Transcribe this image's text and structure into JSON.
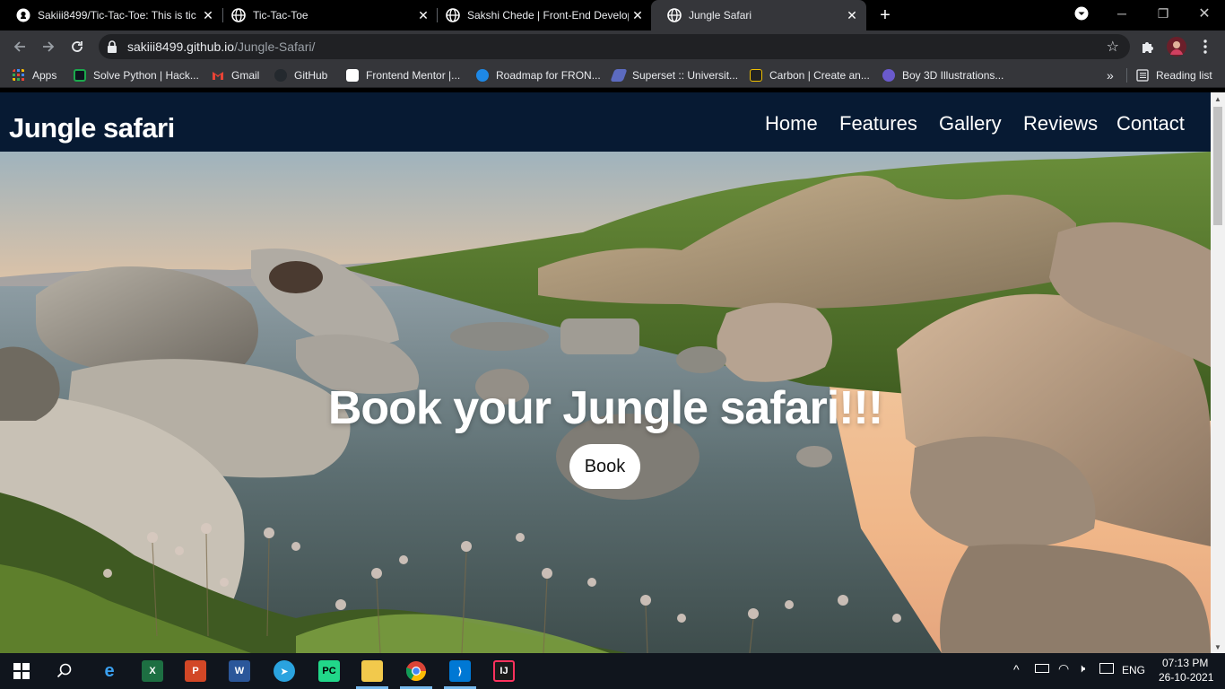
{
  "browser": {
    "tabs": [
      {
        "title": "Sakiii8499/Tic-Tac-Toe: This is tic",
        "icon": "github-icon",
        "active": false
      },
      {
        "title": "Tic-Tac-Toe",
        "icon": "globe-icon",
        "active": false
      },
      {
        "title": "Sakshi Chede | Front-End Develop",
        "icon": "globe-icon",
        "active": false
      },
      {
        "title": "Jungle Safari",
        "icon": "globe-icon",
        "active": true
      }
    ],
    "url_host": "sakiii8499.github.io",
    "url_path": "/Jungle-Safari/",
    "bookmarks": [
      {
        "label": "Apps",
        "color": "#4285f4"
      },
      {
        "label": "Solve Python | Hack...",
        "color": "#1ba94c"
      },
      {
        "label": "Gmail",
        "color": "#ea4335"
      },
      {
        "label": "GitHub",
        "color": "#24292e"
      },
      {
        "label": "Frontend Mentor |...",
        "color": "#ffffff"
      },
      {
        "label": "Roadmap for FRON...",
        "color": "#1e88e5"
      },
      {
        "label": "Superset :: Universit...",
        "color": "#5c6bc0"
      },
      {
        "label": "Carbon | Create an...",
        "color": "#222222"
      },
      {
        "label": "Boy 3D Illustrations...",
        "color": "#6a5acd"
      }
    ],
    "overflow_label": "»",
    "reading_list_label": "Reading list"
  },
  "site": {
    "brand": "Jungle safari",
    "nav": [
      "Home",
      "Features",
      "Gallery",
      "Reviews",
      "Contact"
    ],
    "headline": "Book your Jungle safari!!!",
    "cta_label": "Book"
  },
  "taskbar": {
    "apps": [
      "start",
      "search",
      "edge",
      "excel",
      "powerpoint",
      "word",
      "telegram",
      "pycharm",
      "file-explorer",
      "chrome",
      "vscode",
      "intellij"
    ],
    "language": "ENG",
    "time": "07:13 PM",
    "date": "26-10-2021"
  }
}
